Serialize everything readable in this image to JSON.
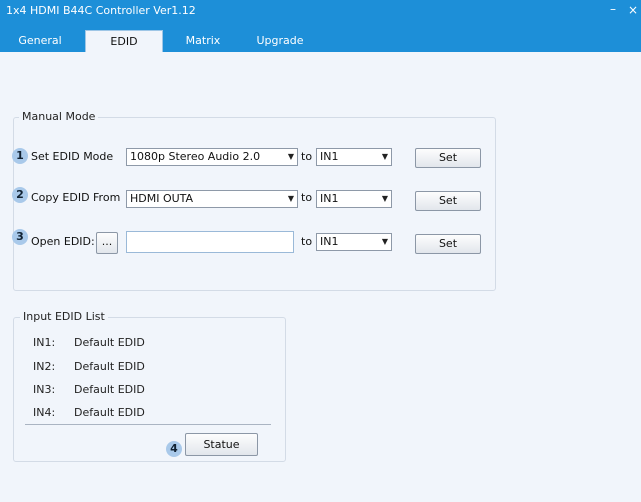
{
  "window": {
    "title": "1x4 HDMI B44C Controller Ver1.12",
    "minimize_glyph": "–",
    "close_glyph": "×"
  },
  "tabs": [
    {
      "label": "General",
      "active": false
    },
    {
      "label": "EDID",
      "active": true
    },
    {
      "label": "Matrix",
      "active": false
    },
    {
      "label": "Upgrade",
      "active": false
    }
  ],
  "manual_mode": {
    "legend": "Manual Mode",
    "rows": [
      {
        "badge": "1",
        "label": "Set EDID Mode",
        "source_value": "1080p Stereo Audio 2.0",
        "to_label": "to",
        "target_value": "IN1",
        "button": "Set"
      },
      {
        "badge": "2",
        "label": "Copy EDID From",
        "source_value": "HDMI OUTA",
        "to_label": "to",
        "target_value": "IN1",
        "button": "Set"
      },
      {
        "badge": "3",
        "label": "Open EDID:",
        "browse_button": "...",
        "file_value": "",
        "to_label": "to",
        "target_value": "IN1",
        "button": "Set"
      }
    ]
  },
  "input_list": {
    "legend": "Input EDID List",
    "items": [
      {
        "port": "IN1:",
        "value": "Default EDID"
      },
      {
        "port": "IN2:",
        "value": "Default EDID"
      },
      {
        "port": "IN3:",
        "value": "Default EDID"
      },
      {
        "port": "IN4:",
        "value": "Default EDID"
      }
    ],
    "badge": "4",
    "status_button": "Statue"
  },
  "colors": {
    "titlebar": "#1d8fd8",
    "background": "#f1f5fb",
    "badge": "#a9c9ea"
  },
  "icons": {
    "dropdown": "chevron-down-icon",
    "minimize": "minimize-icon",
    "close": "close-icon"
  }
}
